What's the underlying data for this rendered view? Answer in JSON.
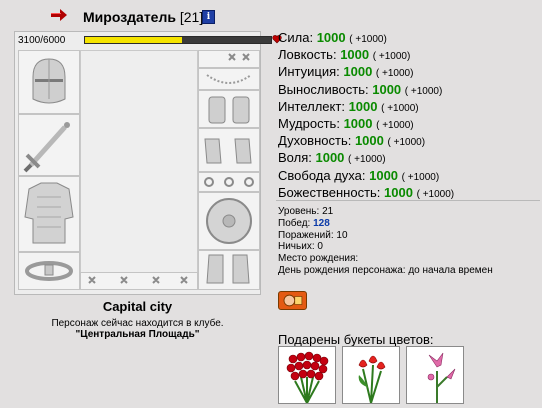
{
  "character": {
    "name": "Мироздатель",
    "level": "[21]",
    "info_icon": "i",
    "hp": "3100/6000",
    "hp_fraction": 0.52
  },
  "stats": [
    {
      "label": "Сила:",
      "value": "1000",
      "bonus": "( +1000)"
    },
    {
      "label": "Ловкость:",
      "value": "1000",
      "bonus": "( +1000)"
    },
    {
      "label": "Интуиция:",
      "value": "1000",
      "bonus": "( +1000)"
    },
    {
      "label": "Выносливость:",
      "value": "1000",
      "bonus": "( +1000)"
    },
    {
      "label": "Интеллект:",
      "value": "1000",
      "bonus": "( +1000)"
    },
    {
      "label": "Мудрость:",
      "value": "1000",
      "bonus": "( +1000)"
    },
    {
      "label": "Духовность:",
      "value": "1000",
      "bonus": "( +1000)"
    },
    {
      "label": "Воля:",
      "value": "1000",
      "bonus": "( +1000)"
    },
    {
      "label": "Свобода духа:",
      "value": "1000",
      "bonus": "( +1000)"
    },
    {
      "label": "Божественность:",
      "value": "1000",
      "bonus": "( +1000)"
    }
  ],
  "info": {
    "level_label": "Уровень:",
    "level_value": "21",
    "wins_label": "Побед:",
    "wins_value": "128",
    "losses_label": "Поражений:",
    "losses_value": "10",
    "draws_label": "Ничьих:",
    "draws_value": "0",
    "birthplace_label": "Место рождения:",
    "birthday_line": "День рождения персонажа: до начала времен"
  },
  "location": {
    "city": "Capital city",
    "status": "Персонаж сейчас находится в клубе.",
    "club": "\"Центральная Площадь\""
  },
  "flowers_title": "Подарены букеты цветов:",
  "icons": [
    "arrow-icon",
    "info-icon",
    "heart-icon",
    "helmet-icon",
    "sword-icon",
    "armor-icon",
    "belt-icon",
    "necklace-icon",
    "bracers-icon",
    "gloves-icon",
    "ring-icon",
    "shield-icon",
    "boots-icon",
    "badge-icon",
    "rose-bouquet",
    "tulip-bouquet",
    "lily-bouquet"
  ],
  "colors": {
    "stat_value": "#0a8a00",
    "hp_fill": "#f5e400",
    "wins": "#0b3aa8"
  }
}
